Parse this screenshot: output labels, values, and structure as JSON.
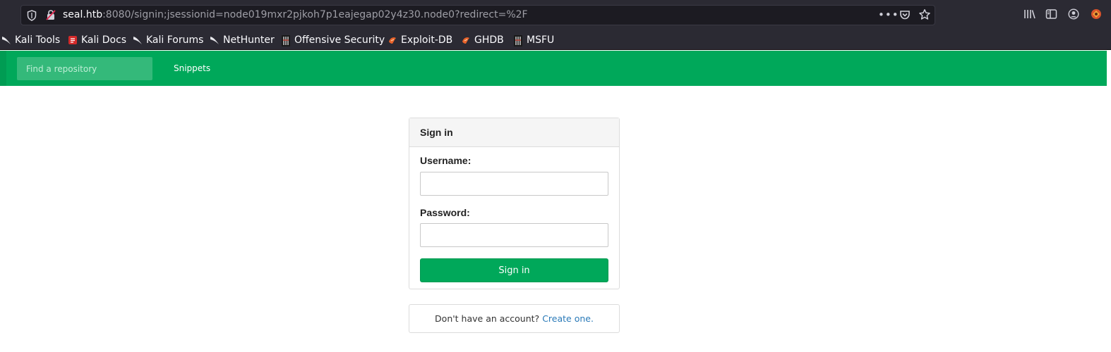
{
  "browser": {
    "url_host": "seal.htb",
    "url_rest": ":8080/signin;jsessionid=node019mxr2pjkoh7p1eajegap02y4z30.node0?redirect=%2F",
    "more_label": "•••"
  },
  "bookmarks": [
    {
      "label": "Kali Tools",
      "icon": "kali-dragon-icon"
    },
    {
      "label": "Kali Docs",
      "icon": "kali-docs-icon"
    },
    {
      "label": "Kali Forums",
      "icon": "kali-dragon-icon"
    },
    {
      "label": "NetHunter",
      "icon": "kali-dragon-icon"
    },
    {
      "label": "Offensive Security",
      "icon": "offsec-icon"
    },
    {
      "label": "Exploit-DB",
      "icon": "exploitdb-icon"
    },
    {
      "label": "GHDB",
      "icon": "exploitdb-icon"
    },
    {
      "label": "MSFU",
      "icon": "offsec-icon"
    }
  ],
  "navbar": {
    "search_placeholder": "Find a repository",
    "snippets_label": "Snippets"
  },
  "signin": {
    "title": "Sign in",
    "username_label": "Username:",
    "username_value": "",
    "password_label": "Password:",
    "password_value": "",
    "button_label": "Sign in"
  },
  "register": {
    "prompt": "Don't have an account?",
    "link": "Create one."
  },
  "colors": {
    "brand_green": "#00a85a",
    "link_blue": "#2a7ab8",
    "browser_chrome": "#2b2a33"
  }
}
